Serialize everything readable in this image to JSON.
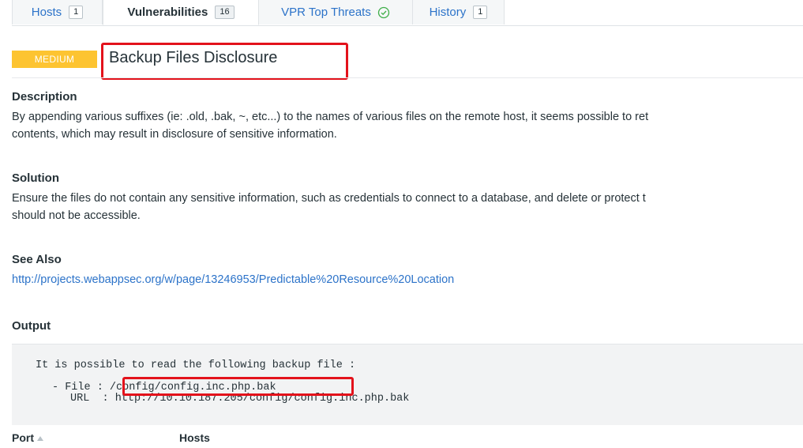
{
  "tabs": [
    {
      "label": "Hosts",
      "count": "1"
    },
    {
      "label": "Vulnerabilities",
      "count": "16"
    },
    {
      "label": "VPR Top Threats"
    },
    {
      "label": "History",
      "count": "1"
    }
  ],
  "severity": "MEDIUM",
  "title": "Backup Files Disclosure",
  "description": {
    "heading": "Description",
    "line1": "By appending various suffixes (ie: .old, .bak, ~, etc...) to the names of various files on the remote host, it seems possible to ret",
    "line2": "contents, which may result in disclosure of sensitive information."
  },
  "solution": {
    "heading": "Solution",
    "line1": "Ensure the files do not contain any sensitive information, such as credentials to connect to a database, and delete or protect t",
    "line2": "should not be accessible."
  },
  "see_also": {
    "heading": "See Also",
    "link": "http://projects.webappsec.org/w/page/13246953/Predictable%20Resource%20Location"
  },
  "output": {
    "heading": "Output",
    "line1": "It is possible to read the following backup file :",
    "file_label": "- File : ",
    "file_value": "/config/config.inc.php.bak",
    "url_label": "URL  : ",
    "url_value": "http://10.10.187.205/config/config.inc.php.bak"
  },
  "table": {
    "col_port": "Port",
    "col_hosts": "Hosts"
  },
  "colors": {
    "severity_medium": "#fdc431",
    "link": "#2c73c9",
    "annotation": "#e3121b"
  }
}
